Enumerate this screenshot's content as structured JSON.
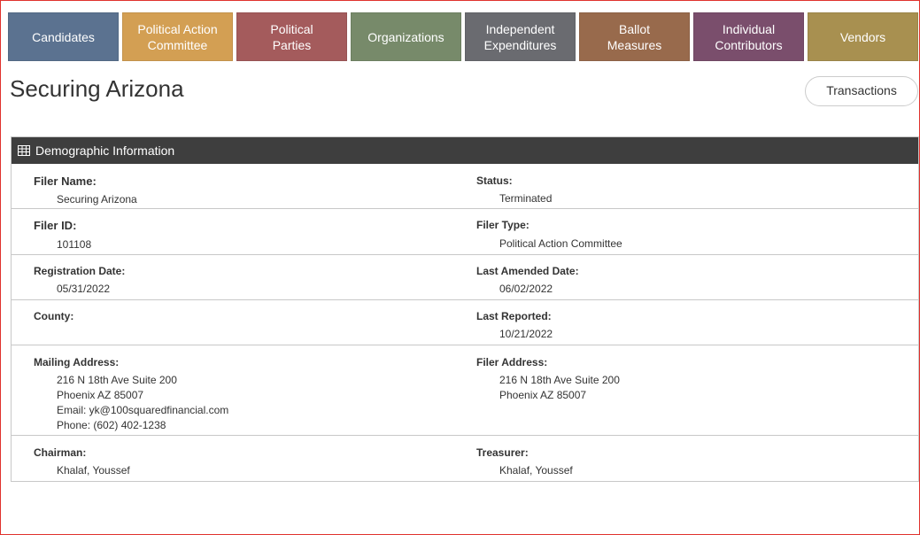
{
  "nav": {
    "tabs": [
      {
        "label": "Candidates",
        "color": "#5b7290"
      },
      {
        "label": "Political Action\nCommittee",
        "color": "#d39f53"
      },
      {
        "label": "Political\nParties",
        "color": "#a45b5c"
      },
      {
        "label": "Organizations",
        "color": "#778a6a"
      },
      {
        "label": "Independent\nExpenditures",
        "color": "#6a6b70"
      },
      {
        "label": "Ballot\nMeasures",
        "color": "#986a4c"
      },
      {
        "label": "Individual\nContributors",
        "color": "#7a4e6c"
      },
      {
        "label": "Vendors",
        "color": "#a89050"
      }
    ]
  },
  "page": {
    "title": "Securing Arizona",
    "transactions_label": "Transactions"
  },
  "panel": {
    "header": "Demographic Information",
    "icon": "table-icon",
    "header_color": "#3e3e3e",
    "fields": {
      "filer_name": {
        "label": "Filer Name:",
        "value": "Securing Arizona"
      },
      "status": {
        "label": "Status:",
        "value": "Terminated"
      },
      "filer_id": {
        "label": "Filer ID:",
        "value": "101108"
      },
      "filer_type": {
        "label": "Filer Type:",
        "value": "Political Action Committee"
      },
      "registration_date": {
        "label": "Registration Date:",
        "value": "05/31/2022"
      },
      "last_amended_date": {
        "label": "Last Amended Date:",
        "value": "06/02/2022"
      },
      "county": {
        "label": "County:",
        "value": ""
      },
      "last_reported": {
        "label": "Last Reported:",
        "value": "10/21/2022"
      },
      "mailing_address": {
        "label": "Mailing Address:",
        "line1": "216 N 18th Ave Suite 200",
        "line2": "Phoenix AZ 85007",
        "email": "Email: yk@100squaredfinancial.com",
        "phone": "Phone: (602) 402-1238"
      },
      "filer_address": {
        "label": "Filer Address:",
        "line1": "216 N 18th Ave Suite 200",
        "line2": "Phoenix AZ 85007"
      },
      "chairman": {
        "label": "Chairman:",
        "value": "Khalaf, Youssef"
      },
      "treasurer": {
        "label": "Treasurer:",
        "value": "Khalaf, Youssef"
      }
    }
  }
}
